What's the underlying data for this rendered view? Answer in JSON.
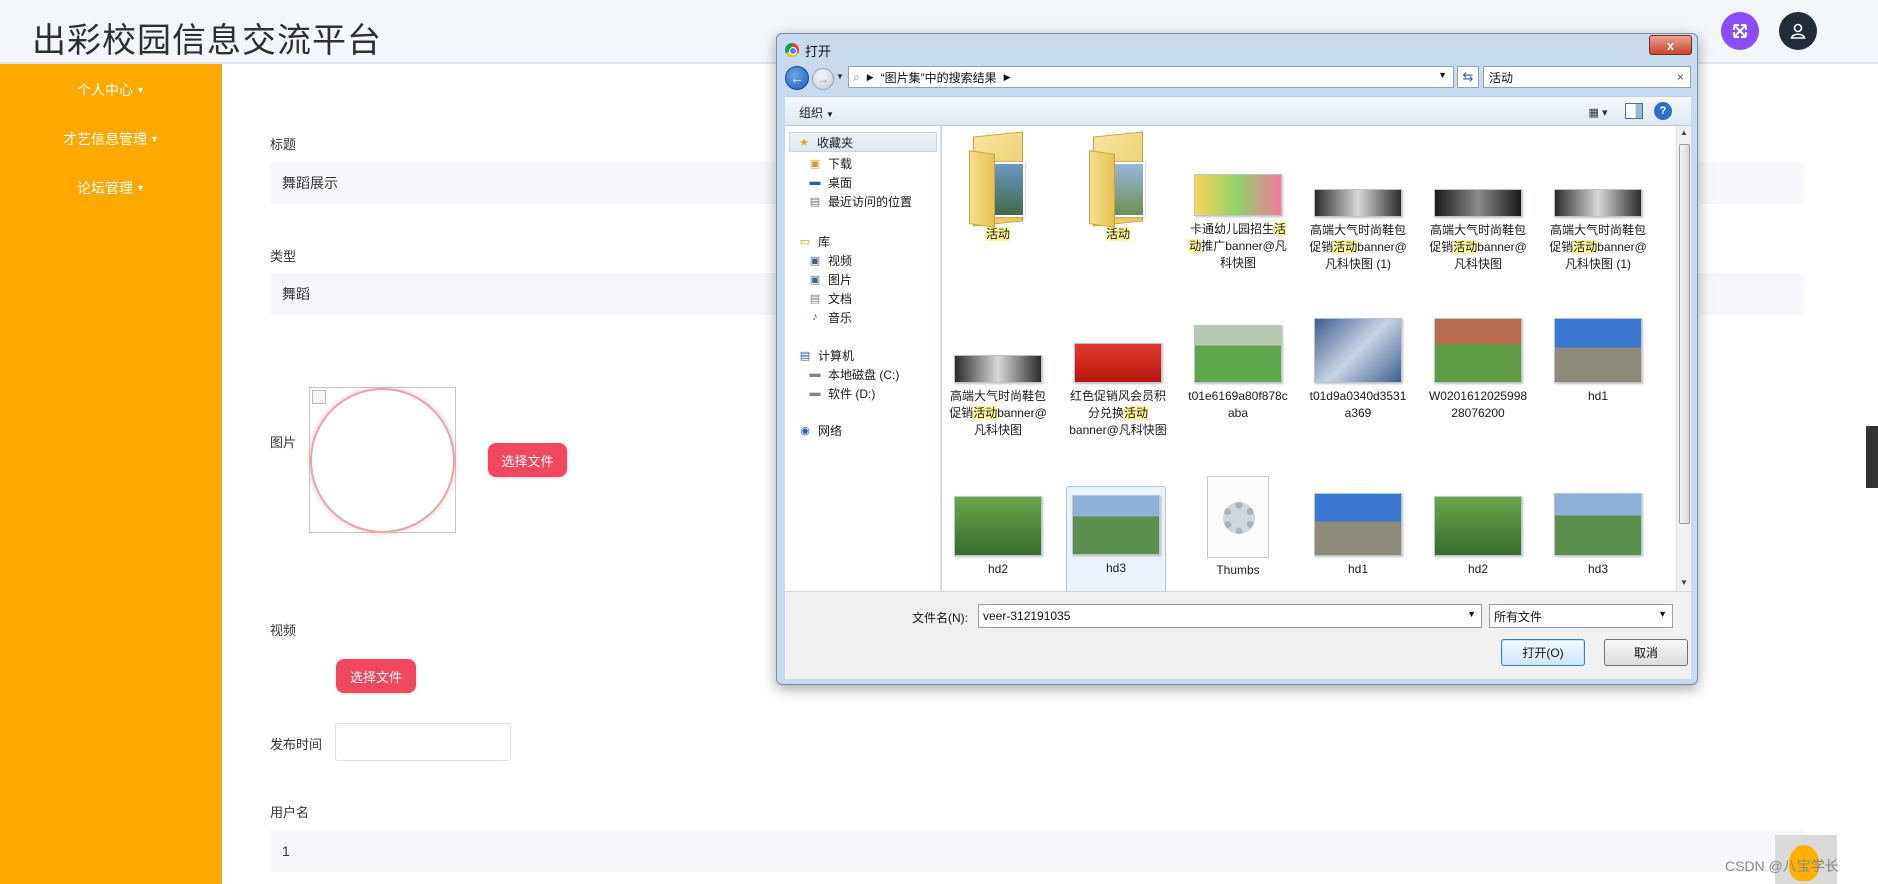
{
  "header": {
    "title": "出彩校园信息交流平台"
  },
  "sidebar": {
    "items": [
      {
        "label": "个人中心"
      },
      {
        "label": "才艺信息管理"
      },
      {
        "label": "论坛管理"
      }
    ]
  },
  "form": {
    "title_label": "标题",
    "title_value": "舞蹈展示",
    "type_label": "类型",
    "type_value": "舞蹈",
    "image_label": "图片",
    "choose_file": "选择文件",
    "video_label": "视频",
    "publish_time_label": "发布时间",
    "publish_time_value": "",
    "username_label": "用户名",
    "username_value": "1"
  },
  "watermark": "CSDN @八宝学长",
  "dialog": {
    "title": "打开",
    "close_symbol": "x",
    "address_crumb": "“图片集”中的搜索结果",
    "search_value": "活动",
    "organize": "组织",
    "nav": {
      "favorites": "收藏夹",
      "downloads": "下载",
      "desktop": "桌面",
      "recent": "最近访问的位置",
      "libraries": "库",
      "videos": "视频",
      "pictures": "图片",
      "documents": "文档",
      "music": "音乐",
      "computer": "计算机",
      "drive_c": "本地磁盘 (C:)",
      "drive_d": "软件 (D:)",
      "network": "网络"
    },
    "files": {
      "f1": {
        "name": "活动"
      },
      "f2": {
        "name": "活动"
      },
      "f3": {
        "pre": "卡通幼儿园招生",
        "hl": "活动",
        "post": "推广banner@凡科快图"
      },
      "f4": {
        "pre": "高端大气时尚鞋包促销",
        "hl": "活动",
        "post": "banner@凡科快图 (1)"
      },
      "f5": {
        "pre": "高端大气时尚鞋包促销",
        "hl": "活动",
        "post": "banner@凡科快图"
      },
      "f6": {
        "pre": "高端大气时尚鞋包促销",
        "hl": "活动",
        "post": "banner@凡科快图 (1)"
      },
      "f7": {
        "pre": "高端大气时尚鞋包促销",
        "hl": "活动",
        "post": "banner@凡科快图"
      },
      "f8": {
        "pre": "红色促销风会员积分兑换",
        "hl": "活动",
        "post": "banner@凡科快图"
      },
      "f9": {
        "name": "t01e6169a80f878caba"
      },
      "f10": {
        "name": "t01d9a0340d3531a369"
      },
      "f11": {
        "name": "W020161202599828076200"
      },
      "f12": {
        "name": "hd1"
      },
      "f13": {
        "name": "hd2"
      },
      "f14": {
        "name": "hd3"
      },
      "f15": {
        "name": "Thumbs"
      },
      "f16": {
        "name": "hd1"
      },
      "f17": {
        "name": "hd2"
      },
      "f18": {
        "name": "hd3"
      }
    },
    "filename_label": "文件名(N):",
    "filename_value": "veer-312191035",
    "filter_value": "所有文件",
    "open_button": "打开(O)",
    "cancel_button": "取消"
  },
  "colors": {
    "sidebar": "#ffa800",
    "accent_button": "#f1475f",
    "header_expand": "#8a4dff",
    "header_user": "#222b3a"
  }
}
